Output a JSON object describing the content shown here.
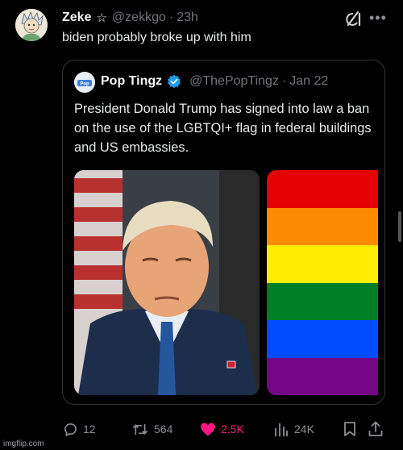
{
  "tweet": {
    "author_name": "Zeke",
    "handle": "@zekkgo",
    "separator": "·",
    "time": "23h",
    "text": "biden probably broke up with him"
  },
  "quoted": {
    "author_name": "Pop Tingz",
    "handle": "@ThePopTingz",
    "separator": "·",
    "date": "Jan 22",
    "text": "President Donald Trump has signed into law a ban on the use of the LGBTQI+ flag in federal buildings and US embassies.",
    "flag_colors": [
      "#e40303",
      "#ff8c00",
      "#ffed00",
      "#008026",
      "#004dff",
      "#750787"
    ]
  },
  "actions": {
    "replies": "12",
    "reposts": "564",
    "likes": "2.5K",
    "views": "24K"
  },
  "watermark": "imgflip.com",
  "colors": {
    "like_pink": "#f91880",
    "verified_blue": "#1d9bf0",
    "muted": "#71767b"
  }
}
